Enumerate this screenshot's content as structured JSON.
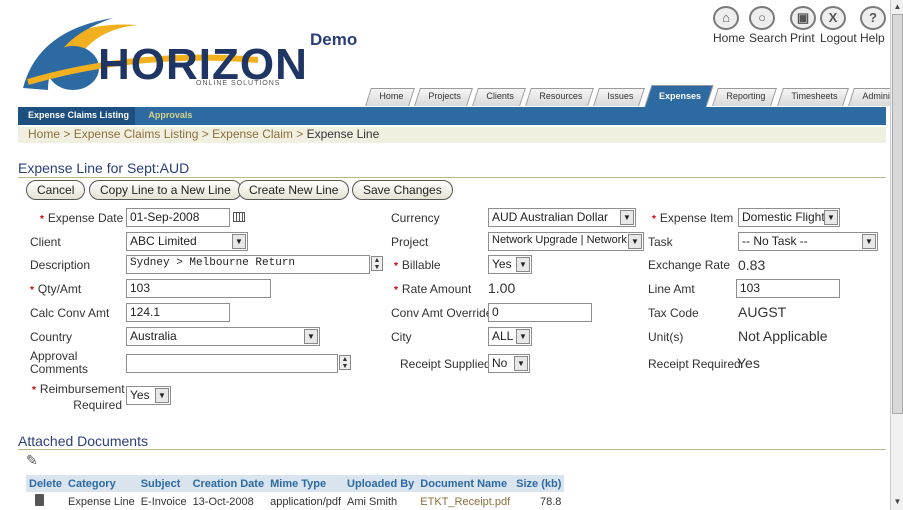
{
  "header": {
    "brand": "HORIZON",
    "brand_tagline": "ONLINE SOLUTIONS",
    "env_label": "Demo",
    "top_links": [
      {
        "icon": "home-icon",
        "label": "Home"
      },
      {
        "icon": "search-icon",
        "label": "Search"
      },
      {
        "icon": "print-icon",
        "label": "Print"
      },
      {
        "icon": "logout-icon",
        "label": "Logout"
      },
      {
        "icon": "help-icon",
        "label": "Help"
      }
    ]
  },
  "tabs": [
    "Home",
    "Projects",
    "Clients",
    "Resources",
    "Issues",
    "Expenses",
    "Reporting",
    "Timesheets",
    "Administration"
  ],
  "active_tab": "Expenses",
  "subnav": {
    "active": "Expense Claims Listing",
    "other": "Approvals"
  },
  "breadcrumb": {
    "links": [
      "Home",
      "Expense Claims Listing",
      "Expense Claim"
    ],
    "current": "Expense Line",
    "separator": ">"
  },
  "section_title": "Expense Line for Sept:AUD",
  "buttons": {
    "cancel": "Cancel",
    "copy": "Copy Line to a New Line",
    "create": "Create New Line",
    "save": "Save Changes"
  },
  "form": {
    "expense_date": {
      "label": "Expense Date",
      "value": "01-Sep-2008"
    },
    "client": {
      "label": "Client",
      "value": "ABC Limited"
    },
    "description": {
      "label": "Description",
      "value": "Sydney > Melbourne Return"
    },
    "qty_amt": {
      "label": "Qty/Amt",
      "value": "103"
    },
    "calc_conv_amt": {
      "label": "Calc Conv Amt",
      "value": "124.1"
    },
    "country": {
      "label": "Country",
      "value": "Australia"
    },
    "approval_comments": {
      "label_line1": "Approval",
      "label_line2": "Comments",
      "value": ""
    },
    "reimbursement": {
      "label_line1": "Reimbursement",
      "label_line2": "Required",
      "value": "Yes"
    },
    "currency": {
      "label": "Currency",
      "value": "AUD Australian Dollar"
    },
    "project": {
      "label": "Project",
      "value": "Network Upgrade | Network"
    },
    "billable": {
      "label": "Billable",
      "value": "Yes"
    },
    "rate_amount": {
      "label": "Rate Amount",
      "value": "1.00"
    },
    "conv_amt_override": {
      "label": "Conv Amt Override",
      "value": "0"
    },
    "city": {
      "label": "City",
      "value": "ALL"
    },
    "receipt_supplied": {
      "label": "Receipt Supplied",
      "value": "No"
    },
    "expense_item": {
      "label": "Expense Item",
      "value": "Domestic Flight"
    },
    "task": {
      "label": "Task",
      "value": "-- No Task --"
    },
    "exchange_rate": {
      "label": "Exchange Rate",
      "value": "0.83"
    },
    "line_amt": {
      "label": "Line Amt",
      "value": "103"
    },
    "tax_code": {
      "label": "Tax Code",
      "value": "AUGST"
    },
    "units": {
      "label": "Unit(s)",
      "value": "Not Applicable"
    },
    "receipt_required": {
      "label": "Receipt Required",
      "value": "Yes"
    }
  },
  "attached": {
    "title": "Attached Documents",
    "columns": [
      "Delete",
      "Category",
      "Subject",
      "Creation Date",
      "Mime Type",
      "Uploaded By",
      "Document Name",
      "Size (kb)"
    ],
    "rows": [
      {
        "category": "Expense Line",
        "subject": "E-Invoice",
        "date": "13-Oct-2008",
        "mime": "application/pdf",
        "uploaded_by": "Ami Smith",
        "doc_name": "ETKT_Receipt.pdf",
        "size": "78.8"
      }
    ]
  },
  "colors": {
    "nav_blue": "#2d6aa2",
    "link_brown": "#8b6f3b",
    "required_red": "#cc0000"
  }
}
